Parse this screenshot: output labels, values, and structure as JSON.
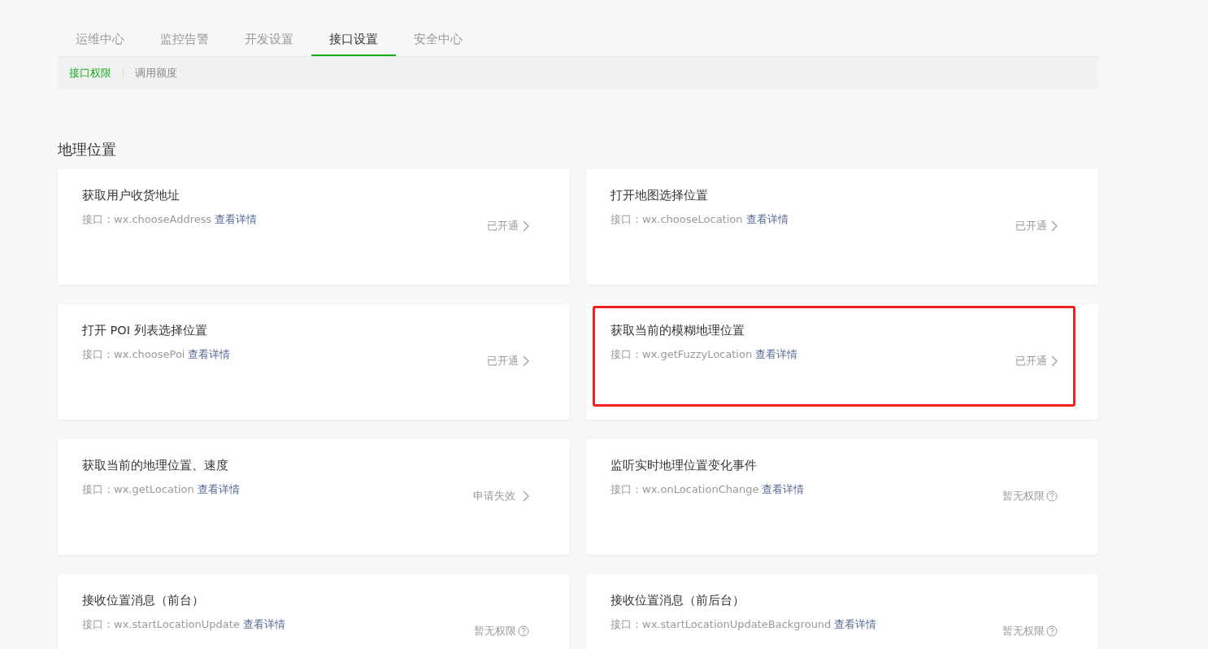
{
  "tabs": [
    {
      "label": "运维中心",
      "selected": false
    },
    {
      "label": "监控告警",
      "selected": false
    },
    {
      "label": "开发设置",
      "selected": false
    },
    {
      "label": "接口设置",
      "selected": true
    },
    {
      "label": "安全中心",
      "selected": false
    }
  ],
  "subtabs": [
    {
      "label": "接口权限",
      "selected": true
    },
    {
      "label": "调用额度",
      "selected": false
    }
  ],
  "section": {
    "title": "地理位置"
  },
  "cards": [
    {
      "title": "获取用户收货地址",
      "api_label": "接口：wx.chooseAddress",
      "link": "查看详情",
      "status": "已开通",
      "kind": "opened",
      "highlighted": false
    },
    {
      "title": "打开地图选择位置",
      "api_label": "接口：wx.chooseLocation",
      "link": "查看详情",
      "status": "已开通",
      "kind": "opened",
      "highlighted": false
    },
    {
      "title": "打开 POI 列表选择位置",
      "api_label": "接口：wx.choosePoi",
      "link": "查看详情",
      "status": "已开通",
      "kind": "opened",
      "highlighted": false
    },
    {
      "title": "获取当前的模糊地理位置",
      "api_label": "接口：wx.getFuzzyLocation",
      "link": "查看详情",
      "status": "已开通",
      "kind": "opened",
      "highlighted": true
    },
    {
      "title": "获取当前的地理位置、速度",
      "api_label": "接口：wx.getLocation",
      "link": "查看详情",
      "status": "申请失效",
      "kind": "failed",
      "highlighted": false
    },
    {
      "title": "监听实时地理位置变化事件",
      "api_label": "接口：wx.onLocationChange",
      "link": "查看详情",
      "status": "暂无权限",
      "kind": "none",
      "highlighted": false
    },
    {
      "title": "接收位置消息（前台）",
      "api_label": "接口：wx.startLocationUpdate",
      "link": "查看详情",
      "status": "暂无权限",
      "kind": "none",
      "highlighted": false
    },
    {
      "title": "接收位置消息（前后台）",
      "api_label": "接口：wx.startLocationUpdateBackground",
      "link": "查看详情",
      "status": "暂无权限",
      "kind": "none",
      "highlighted": false
    }
  ]
}
